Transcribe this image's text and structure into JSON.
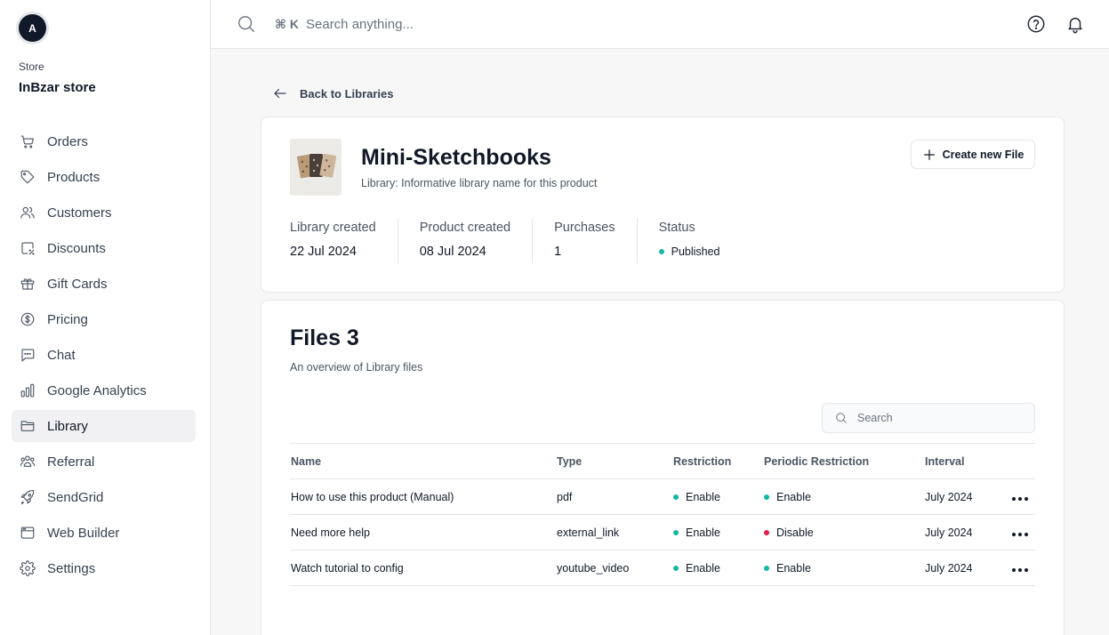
{
  "user": {
    "initial": "A"
  },
  "store": {
    "label": "Store",
    "name": "InBzar store"
  },
  "sidebar": {
    "items": [
      {
        "label": "Orders",
        "icon": "cart-icon"
      },
      {
        "label": "Products",
        "icon": "tag-icon"
      },
      {
        "label": "Customers",
        "icon": "users-icon"
      },
      {
        "label": "Discounts",
        "icon": "discount-icon"
      },
      {
        "label": "Gift Cards",
        "icon": "gift-icon"
      },
      {
        "label": "Pricing",
        "icon": "dollar-icon"
      },
      {
        "label": "Chat",
        "icon": "chat-icon"
      },
      {
        "label": "Google Analytics",
        "icon": "bar-chart-icon"
      },
      {
        "label": "Library",
        "icon": "folder-icon",
        "active": true
      },
      {
        "label": "Referral",
        "icon": "referral-icon"
      },
      {
        "label": "SendGrid",
        "icon": "rocket-icon"
      },
      {
        "label": "Web Builder",
        "icon": "browser-icon"
      },
      {
        "label": "Settings",
        "icon": "gear-icon"
      }
    ]
  },
  "topbar": {
    "shortcut": "⌘ K",
    "search_placeholder": "Search anything..."
  },
  "back_link": "Back to Libraries",
  "product": {
    "title": "Mini-Sketchbooks",
    "subtitle": "Library: Informative library name for this product",
    "create_button": "Create new File",
    "stats": {
      "library_created_label": "Library created",
      "library_created_value": "22 Jul 2024",
      "product_created_label": "Product created",
      "product_created_value": "08 Jul 2024",
      "purchases_label": "Purchases",
      "purchases_value": "1",
      "status_label": "Status",
      "status_value": "Published"
    }
  },
  "files": {
    "title": "Files 3",
    "subtitle": "An overview of Library files",
    "search_placeholder": "Search",
    "columns": [
      "Name",
      "Type",
      "Restriction",
      "Periodic Restriction",
      "Interval"
    ],
    "rows": [
      {
        "name": "How to use this product (Manual)",
        "type": "pdf",
        "restriction": "Enable",
        "periodic": "Enable",
        "interval": "July 2024"
      },
      {
        "name": "Need more help",
        "type": "external_link",
        "restriction": "Enable",
        "periodic": "Disable",
        "interval": "July 2024"
      },
      {
        "name": "Watch tutorial to config",
        "type": "youtube_video",
        "restriction": "Enable",
        "periodic": "Enable",
        "interval": "July 2024"
      }
    ]
  },
  "colors": {
    "enable": "#14b8a6",
    "disable": "#e11d48",
    "published": "#14b8a6"
  }
}
